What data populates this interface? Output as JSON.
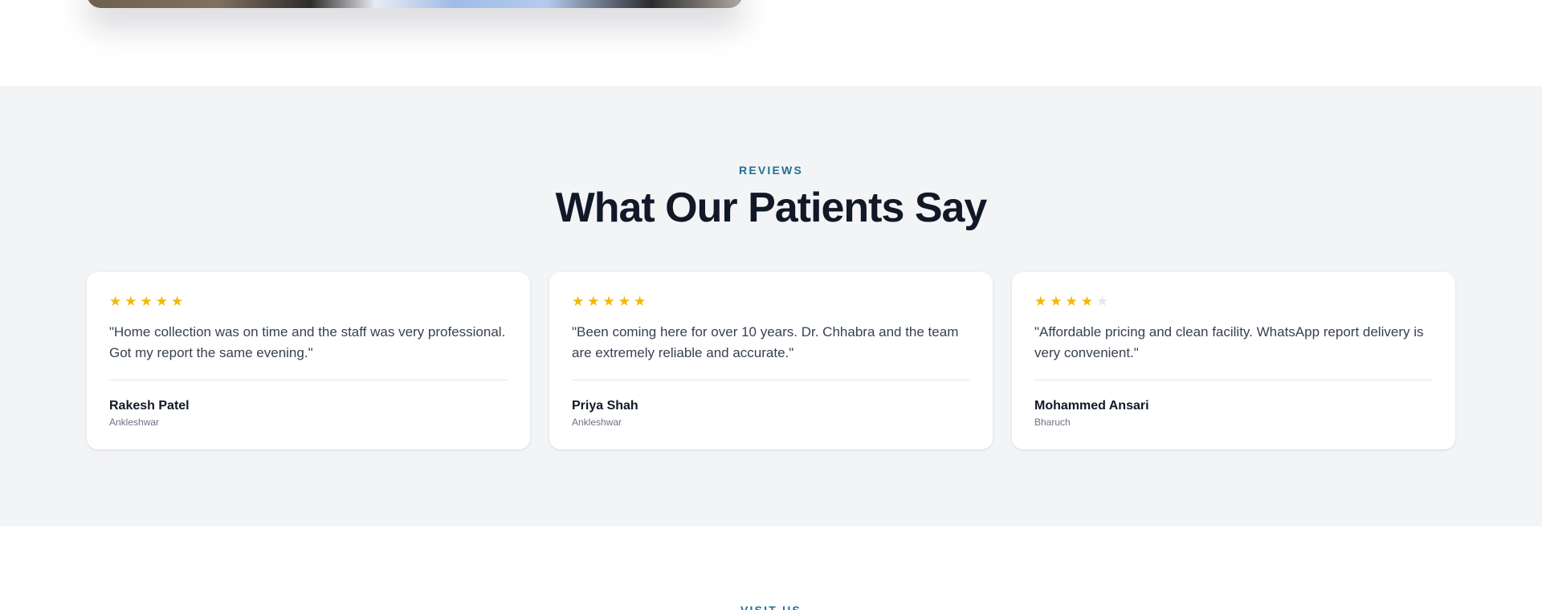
{
  "reviews_section": {
    "eyebrow": "REVIEWS",
    "title": "What Our Patients Say",
    "background": "#f3f4f6",
    "accent": "#217093",
    "star_color": "#f5b700",
    "reviews": [
      {
        "rating": 5,
        "stars": "★★★★★",
        "quote": "\"Home collection was on time and the staff was very professional. Got my report the same evening.\"",
        "author": "Rakesh Patel",
        "location": "Ankleshwar"
      },
      {
        "rating": 5,
        "stars": "★★★★★",
        "quote": "\"Been coming here for over 10 years. Dr. Chhabra and the team are extremely reliable and accurate.\"",
        "author": "Priya Shah",
        "location": "Ankleshwar"
      },
      {
        "rating": 4,
        "stars": "★★★★★",
        "quote": "\"Affordable pricing and clean facility. WhatsApp report delivery is very convenient.\"",
        "author": "Mohammed Ansari",
        "location": "Bharuch"
      }
    ]
  },
  "next_section": {
    "eyebrow": "VISIT US"
  }
}
